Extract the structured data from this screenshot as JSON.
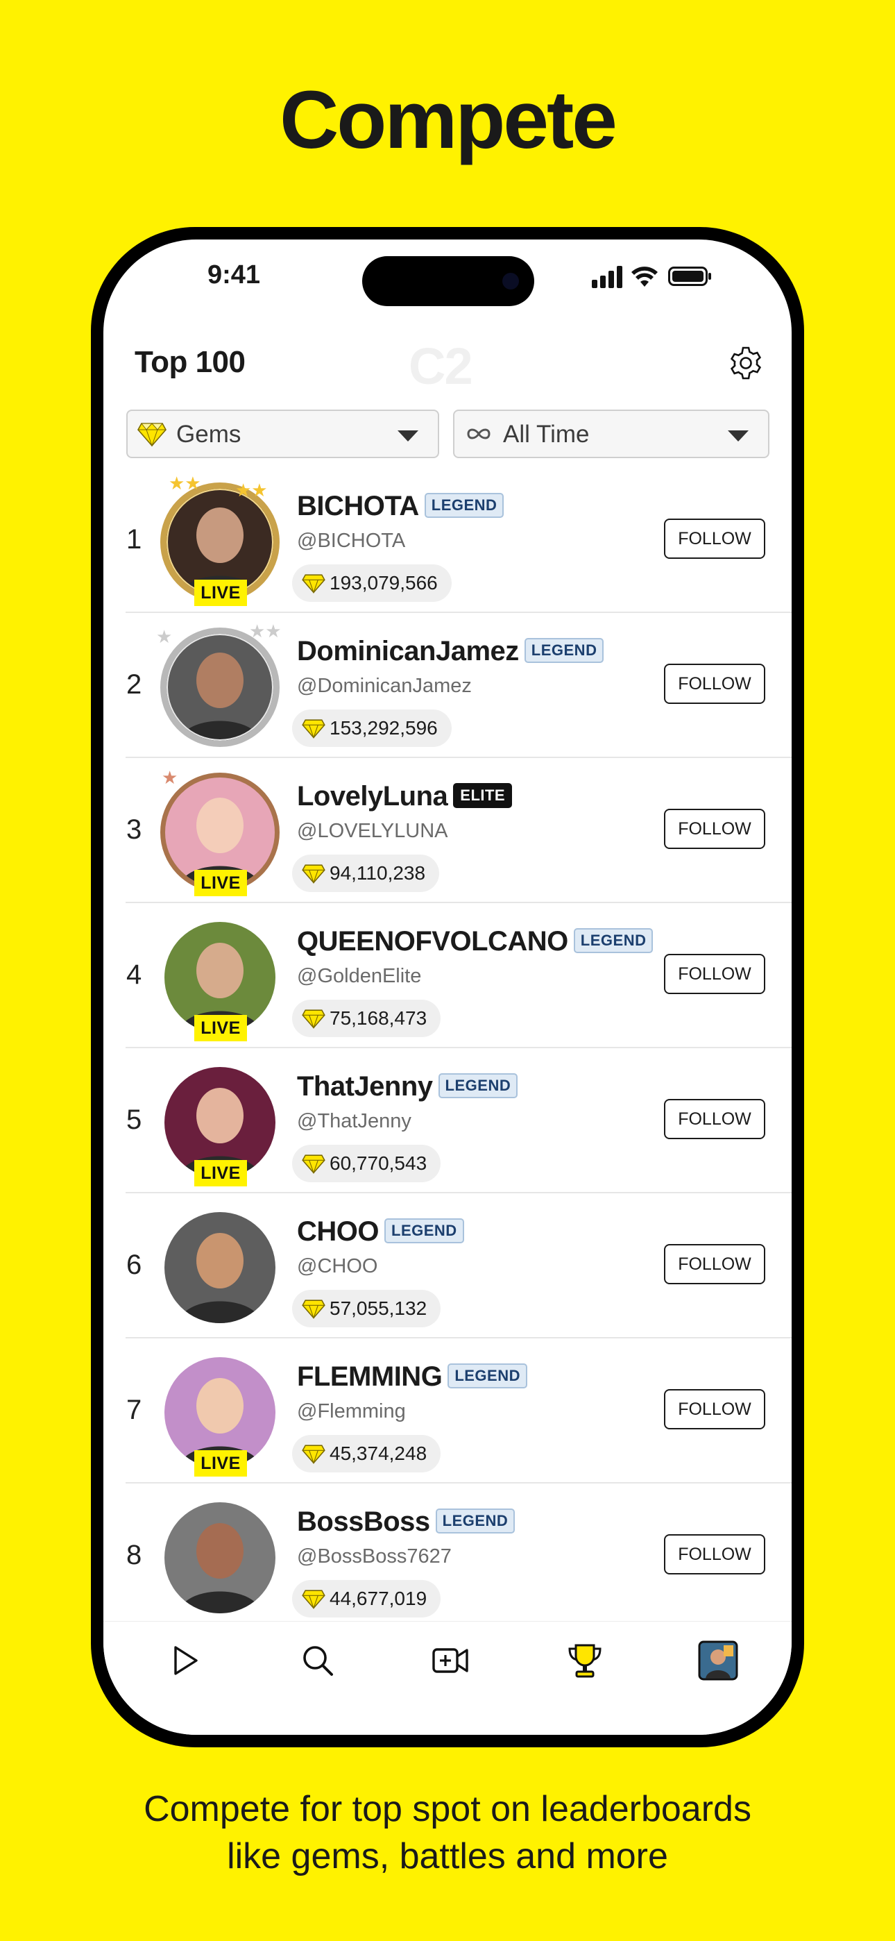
{
  "headline": "Compete",
  "caption_line1": "Compete for top spot on leaderboards",
  "caption_line2": "like gems, battles and more",
  "status": {
    "time": "9:41"
  },
  "header": {
    "title": "Top 100",
    "watermark": "C2"
  },
  "filters": {
    "metric": {
      "label": "Gems",
      "icon": "gem-icon"
    },
    "period": {
      "label": "All Time",
      "icon": "infinity-icon"
    }
  },
  "colors": {
    "brand_yellow": "#FFF200",
    "gold": "#C9A24A",
    "silver": "#B8B8B8",
    "bronze": "#A9734B"
  },
  "leaderboard": [
    {
      "rank": "1",
      "name": "BICHOTA",
      "badge": "LEGEND",
      "handle": "@BICHOTA",
      "gems": "193,079,566",
      "live": "LIVE",
      "follow": "FOLLOW"
    },
    {
      "rank": "2",
      "name": "DominicanJamez",
      "badge": "LEGEND",
      "handle": "@DominicanJamez",
      "gems": "153,292,596",
      "live": "",
      "follow": "FOLLOW"
    },
    {
      "rank": "3",
      "name": "LovelyLuna",
      "badge": "ELITE",
      "handle": "@LOVELYLUNA",
      "gems": "94,110,238",
      "live": "LIVE",
      "follow": "FOLLOW"
    },
    {
      "rank": "4",
      "name": "QUEENOFVOLCANO",
      "badge": "LEGEND",
      "handle": "@GoldenElite",
      "gems": "75,168,473",
      "live": "LIVE",
      "follow": "FOLLOW"
    },
    {
      "rank": "5",
      "name": "ThatJenny",
      "badge": "LEGEND",
      "handle": "@ThatJenny",
      "gems": "60,770,543",
      "live": "LIVE",
      "follow": "FOLLOW"
    },
    {
      "rank": "6",
      "name": "CHOO",
      "badge": "LEGEND",
      "handle": "@CHOO",
      "gems": "57,055,132",
      "live": "",
      "follow": "FOLLOW"
    },
    {
      "rank": "7",
      "name": "FLEMMING",
      "badge": "LEGEND",
      "handle": "@Flemming",
      "gems": "45,374,248",
      "live": "LIVE",
      "follow": "FOLLOW"
    },
    {
      "rank": "8",
      "name": "BossBoss",
      "badge": "LEGEND",
      "handle": "@BossBoss7627",
      "gems": "44,677,019",
      "live": "",
      "follow": "FOLLOW"
    }
  ],
  "tabbar": [
    {
      "icon": "play-icon"
    },
    {
      "icon": "search-icon"
    },
    {
      "icon": "video-add-icon"
    },
    {
      "icon": "trophy-icon"
    },
    {
      "icon": "profile-avatar-icon"
    }
  ]
}
